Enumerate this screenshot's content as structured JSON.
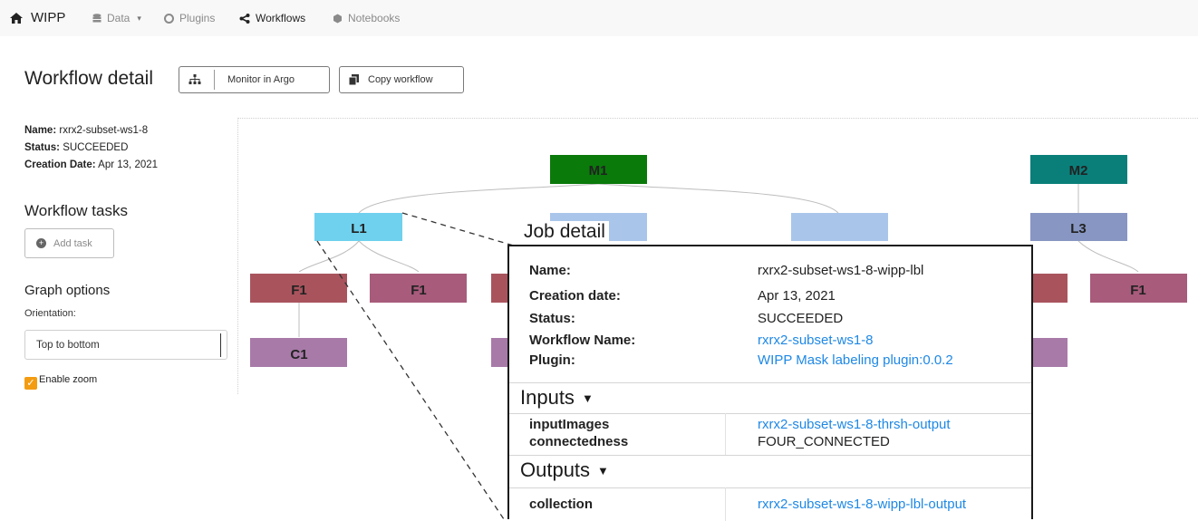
{
  "nav": {
    "brand": "WIPP",
    "items": [
      {
        "label": "Data",
        "icon": "database-icon"
      },
      {
        "label": "Plugins",
        "icon": "cube-icon"
      },
      {
        "label": "Workflows",
        "icon": "share-icon"
      },
      {
        "label": "Notebooks",
        "icon": "notebook-icon"
      }
    ]
  },
  "header": {
    "title": "Workflow detail",
    "monitor_label": "Monitor in Argo",
    "copy_label": "Copy workflow"
  },
  "workflow": {
    "name_label": "Name:",
    "name": "rxrx2-subset-ws1-8",
    "status_label": "Status:",
    "status": "SUCCEEDED",
    "date_label": "Creation Date:",
    "date": "Apr 13, 2021"
  },
  "sidebar": {
    "tasks_title": "Workflow tasks",
    "add_task_label": "Add task",
    "graph_options_title": "Graph options",
    "orientation_label": "Orientation:",
    "orientation_value": "Top to bottom",
    "zoom_label": "Enable zoom",
    "zoom_checked": true
  },
  "graph": {
    "nodes": [
      "M1",
      "M2",
      "L1",
      "L3",
      "F1",
      "F1",
      "F1",
      "C1"
    ],
    "colors": {
      "M1": "#0a7a0a",
      "M2": "#0a7f7a",
      "L1": "#6fd1ee",
      "L3": "#8796c2",
      "F": "#a9545d",
      "F_alt": "#a85b7b",
      "C": "#a87aa8",
      "L_hidden": "#a9c6ea"
    }
  },
  "job": {
    "title": "Job detail",
    "name_label": "Name:",
    "name": "rxrx2-subset-ws1-8-wipp-lbl",
    "date_label": "Creation date:",
    "date": "Apr 13, 2021",
    "status_label": "Status:",
    "status": "SUCCEEDED",
    "workflow_label": "Workflow Name:",
    "workflow": "rxrx2-subset-ws1-8",
    "plugin_label": "Plugin:",
    "plugin": "WIPP Mask labeling plugin:0.0.2",
    "inputs_title": "Inputs",
    "inputs": [
      {
        "key": "inputImages",
        "value": "rxrx2-subset-ws1-8-thrsh-output",
        "link": true
      },
      {
        "key": "connectedness",
        "value": "FOUR_CONNECTED",
        "link": false
      }
    ],
    "outputs_title": "Outputs",
    "outputs": [
      {
        "key": "collection",
        "value": "rxrx2-subset-ws1-8-wipp-lbl-output",
        "link": true
      }
    ]
  }
}
